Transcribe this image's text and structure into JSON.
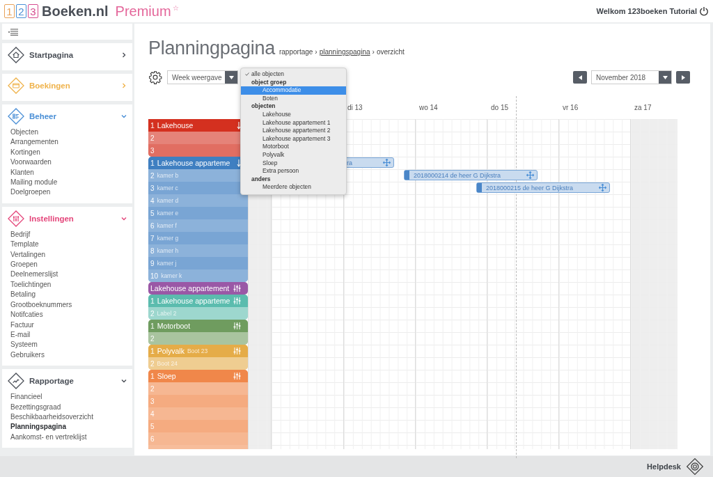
{
  "header": {
    "logo_digits": [
      "1",
      "2",
      "3"
    ],
    "logo_name": "Boeken.nl",
    "logo_tier": "Premium",
    "logo_star": "☆",
    "welcome": "Welkom 123boeken Tutorial"
  },
  "sidebar": {
    "sections": [
      {
        "title": "Startpagina",
        "kind": "home",
        "color": "#4a4f57",
        "expanded": false
      },
      {
        "title": "Boekingen",
        "kind": "bookings",
        "color": "#efb24a",
        "expanded": false
      },
      {
        "title": "Beheer",
        "kind": "manage",
        "color": "#4a8fd6",
        "expanded": true,
        "items": [
          {
            "label": "Objecten",
            "selected": false
          },
          {
            "label": "Arrangementen",
            "selected": false
          },
          {
            "label": "Kortingen",
            "selected": false
          },
          {
            "label": "Voorwaarden",
            "selected": false
          },
          {
            "label": "Klanten",
            "selected": false
          },
          {
            "label": "Mailing module",
            "selected": false
          },
          {
            "label": "Doelgroepen",
            "selected": false
          }
        ]
      },
      {
        "title": "Instellingen",
        "kind": "settings",
        "color": "#e4457a",
        "expanded": true,
        "items": [
          {
            "label": "Bedrijf",
            "selected": false
          },
          {
            "label": "Template",
            "selected": false
          },
          {
            "label": "Vertalingen",
            "selected": false
          },
          {
            "label": "Groepen",
            "selected": false
          },
          {
            "label": "Deelnemerslijst",
            "selected": false
          },
          {
            "label": "Toelichtingen",
            "selected": false
          },
          {
            "label": "Betaling",
            "selected": false
          },
          {
            "label": "Grootboeknummers",
            "selected": false
          },
          {
            "label": "Notifcaties",
            "selected": false
          },
          {
            "label": "Factuur",
            "selected": false
          },
          {
            "label": "E-mail",
            "selected": false
          },
          {
            "label": "Systeem",
            "selected": false
          },
          {
            "label": "Gebruikers",
            "selected": false
          }
        ]
      },
      {
        "title": "Rapportage",
        "kind": "reports",
        "color": "#4a4f57",
        "expanded": true,
        "items": [
          {
            "label": "Financieel",
            "selected": false
          },
          {
            "label": "Bezettingsgraad",
            "selected": false
          },
          {
            "label": "Beschikbaarheidsoverzicht",
            "selected": false
          },
          {
            "label": "Planningspagina",
            "selected": true
          },
          {
            "label": "Aankomst- en vertreklijst",
            "selected": false
          }
        ]
      }
    ]
  },
  "page": {
    "title": "Planningpagina",
    "breadcrumb": [
      {
        "label": "rapportage",
        "link": false
      },
      {
        "label": "planningspagina",
        "link": true
      },
      {
        "label": "overzicht",
        "link": false
      }
    ],
    "separator": "›"
  },
  "toolbar": {
    "view_select": "Week weergave",
    "month_select": "November 2018"
  },
  "object_menu": [
    {
      "kind": "option",
      "label": "alle objecten",
      "checked": true,
      "selected": false
    },
    {
      "kind": "group",
      "label": "object groep"
    },
    {
      "kind": "option",
      "label": "Accommodatie",
      "checked": false,
      "selected": true
    },
    {
      "kind": "option",
      "label": "Boten",
      "checked": false,
      "selected": false
    },
    {
      "kind": "group",
      "label": "objecten"
    },
    {
      "kind": "option",
      "label": "Lakehouse",
      "checked": false,
      "selected": false
    },
    {
      "kind": "option",
      "label": "Lakehouse appartement 1",
      "checked": false,
      "selected": false
    },
    {
      "kind": "option",
      "label": "Lakehouse appartement 2",
      "checked": false,
      "selected": false
    },
    {
      "kind": "option",
      "label": "Lakehouse appartement 3",
      "checked": false,
      "selected": false
    },
    {
      "kind": "option",
      "label": "Motorboot",
      "checked": false,
      "selected": false
    },
    {
      "kind": "option",
      "label": "Polyvalk",
      "checked": false,
      "selected": false
    },
    {
      "kind": "option",
      "label": "Sloep",
      "checked": false,
      "selected": false
    },
    {
      "kind": "option",
      "label": "Extra persoon",
      "checked": false,
      "selected": false
    },
    {
      "kind": "group",
      "label": "anders"
    },
    {
      "kind": "option",
      "label": "Meerdere objecten",
      "checked": false,
      "selected": false
    }
  ],
  "days": [
    {
      "label": "di 13",
      "weekend": false
    },
    {
      "label": "wo 14",
      "weekend": false
    },
    {
      "label": "do 15",
      "weekend": false
    },
    {
      "label": "vr 16",
      "weekend": false
    },
    {
      "label": "za 17",
      "weekend": true
    }
  ],
  "object_groups": [
    {
      "color": "#d4301f",
      "kind": "sort",
      "rows": [
        {
          "num": "1",
          "name": "Lakehouse"
        },
        {
          "num": "2"
        },
        {
          "num": "3"
        }
      ]
    },
    {
      "color": "#3f7fc1",
      "kind": "sort",
      "rows": [
        {
          "num": "1",
          "name": "Lakehouse apparteme",
          "booking": {
            "label": "ra"
          }
        },
        {
          "num": "2",
          "sub": "kamer b",
          "booking": {
            "label": "2018000214 de heer G Dijkstra"
          }
        },
        {
          "num": "3",
          "sub": "kamer c",
          "booking": {
            "label": "2018000215 de heer G Dijkstra"
          }
        },
        {
          "num": "4",
          "sub": "kamer d"
        },
        {
          "num": "5",
          "sub": "kamer e"
        },
        {
          "num": "6",
          "sub": "kamer f"
        },
        {
          "num": "7",
          "sub": "kamer g"
        },
        {
          "num": "8",
          "sub": "kamer h"
        },
        {
          "num": "9",
          "sub": "kamer j"
        },
        {
          "num": "10",
          "sub": "kamer k"
        }
      ]
    },
    {
      "color": "#9a58a6",
      "kind": "filter",
      "rows": [
        {
          "name": "Lakehouse appartement"
        }
      ]
    },
    {
      "color": "#5bbcae",
      "kind": "filter",
      "rows": [
        {
          "num": "1",
          "name": "Lakehouse apparteme"
        },
        {
          "num": "2",
          "sub": "Label 2"
        }
      ]
    },
    {
      "color": "#6f9c5f",
      "kind": "filter",
      "rows": [
        {
          "num": "1",
          "name": "Motorboot"
        },
        {
          "num": "2"
        }
      ]
    },
    {
      "color": "#e5ac48",
      "kind": "filter",
      "rows": [
        {
          "num": "1",
          "name": "Polyvalk",
          "sub": "Boot 23"
        },
        {
          "num": "2",
          "sub": "Boot 24"
        }
      ]
    },
    {
      "color": "#f0874a",
      "kind": "filter",
      "rows": [
        {
          "num": "1",
          "name": "Sloep"
        },
        {
          "num": "2"
        },
        {
          "num": "3"
        },
        {
          "num": "4"
        },
        {
          "num": "5"
        },
        {
          "num": "6"
        }
      ]
    }
  ],
  "footer": {
    "helpdesk": "Helpdesk"
  }
}
